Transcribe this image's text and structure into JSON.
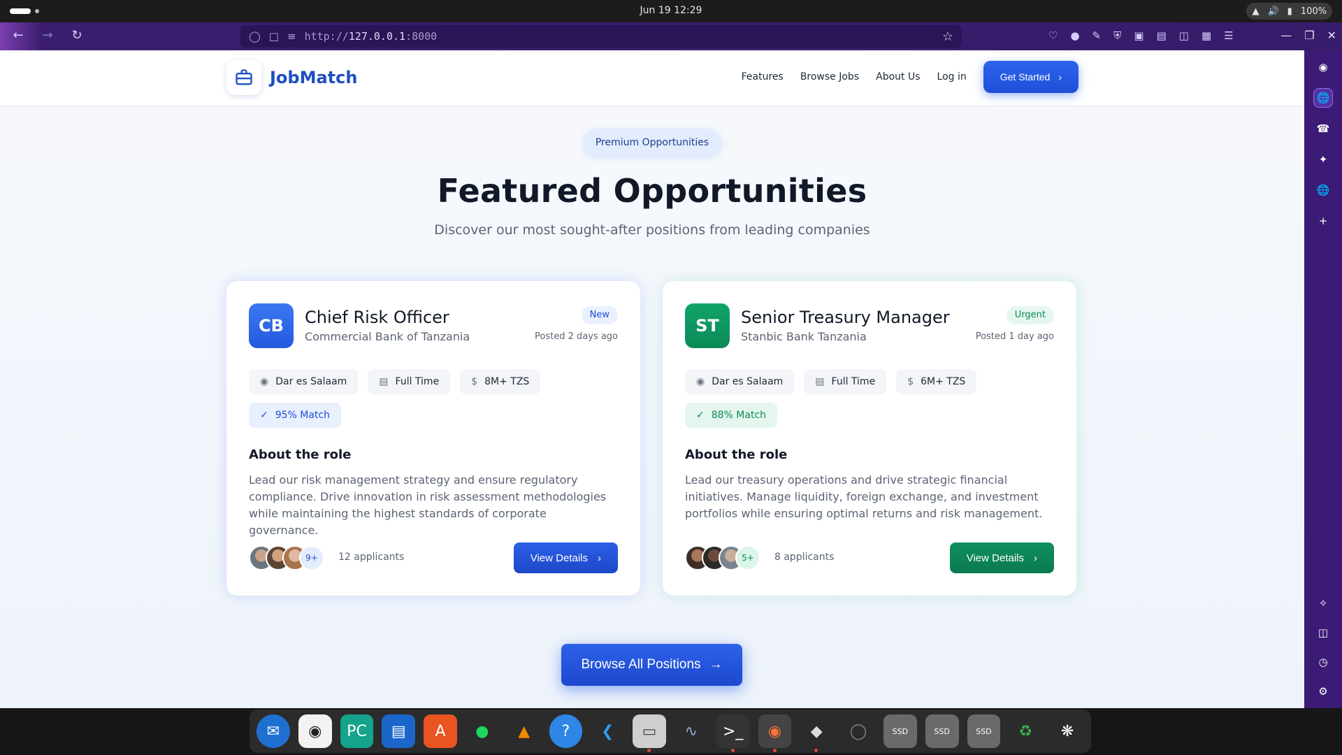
{
  "os": {
    "clock": "Jun 19  12:29",
    "battery": "100%"
  },
  "browser": {
    "url_prefix": "http://",
    "url_host": "127.0.0.1",
    "url_port": ":8000"
  },
  "site": {
    "brand": "JobMatch",
    "nav": [
      "Features",
      "Browse Jobs",
      "About Us",
      "Log in"
    ],
    "cta": "Get Started"
  },
  "hero": {
    "badge": "Premium Opportunities",
    "title": "Featured Opportunities",
    "subtitle": "Discover our most sought-after positions from leading companies"
  },
  "jobs": [
    {
      "initials": "CB",
      "title": "Chief Risk Officer",
      "company": "Commercial Bank of Tanzania",
      "tag": "New",
      "posted": "Posted 2 days ago",
      "location": "Dar es Salaam",
      "type": "Full Time",
      "salary": "8M+ TZS",
      "match": "95% Match",
      "about_heading": "About the role",
      "about": "Lead our risk management strategy and ensure regulatory compliance. Drive innovation in risk assessment methodologies while maintaining the highest standards of corporate governance.",
      "more": "9+",
      "applicants": "12 applicants",
      "button": "View Details",
      "accent": "#2459de"
    },
    {
      "initials": "ST",
      "title": "Senior Treasury Manager",
      "company": "Stanbic Bank Tanzania",
      "tag": "Urgent",
      "posted": "Posted 1 day ago",
      "location": "Dar es Salaam",
      "type": "Full Time",
      "salary": "6M+ TZS",
      "match": "88% Match",
      "about_heading": "About the role",
      "about": "Lead our treasury operations and drive strategic financial initiatives. Manage liquidity, foreign exchange, and investment portfolios while ensuring optimal returns and risk management.",
      "more": "5+",
      "applicants": "8 applicants",
      "button": "View Details",
      "accent": "#0b8a58"
    }
  ],
  "browse_all": "Browse All Positions"
}
